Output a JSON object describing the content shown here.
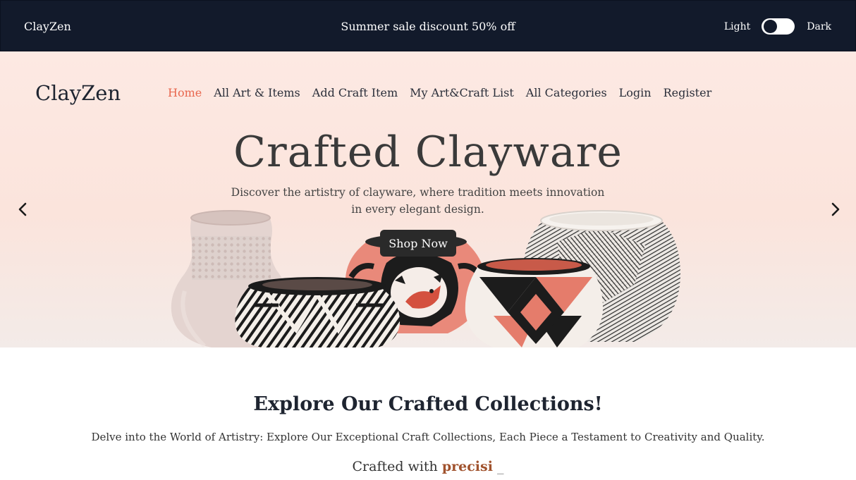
{
  "topbar": {
    "brand": "ClayZen",
    "promo": "Summer sale discount 50% off",
    "theme_light_label": "Light",
    "theme_dark_label": "Dark"
  },
  "header": {
    "logo": "ClayZen",
    "nav": [
      {
        "label": "Home",
        "active": true
      },
      {
        "label": "All Art & Items"
      },
      {
        "label": "Add Craft Item"
      },
      {
        "label": "My Art&Craft List"
      },
      {
        "label": "All Categories"
      },
      {
        "label": "Login"
      },
      {
        "label": "Register"
      }
    ]
  },
  "hero": {
    "title": "Crafted Clayware",
    "subtitle": "Discover the artistry of clayware, where tradition meets innovation in every elegant design.",
    "cta_label": "Shop Now",
    "prev_icon": "chevron-left-icon",
    "next_icon": "chevron-right-icon"
  },
  "collections": {
    "title": "Explore Our Crafted Collections!",
    "description": "Delve into the World of Artistry: Explore Our Exceptional Craft Collections, Each Piece a Testament to Creativity and Quality.",
    "typed_prefix": "Crafted with",
    "typed_word": "precisi",
    "typed_cursor": "_"
  },
  "colors": {
    "topbar_bg": "#121a2b",
    "accent_active": "#e8674e",
    "hero_bg": "#fde9e3",
    "button_bg": "#2a2a2a",
    "typed_word": "#a0522d"
  }
}
